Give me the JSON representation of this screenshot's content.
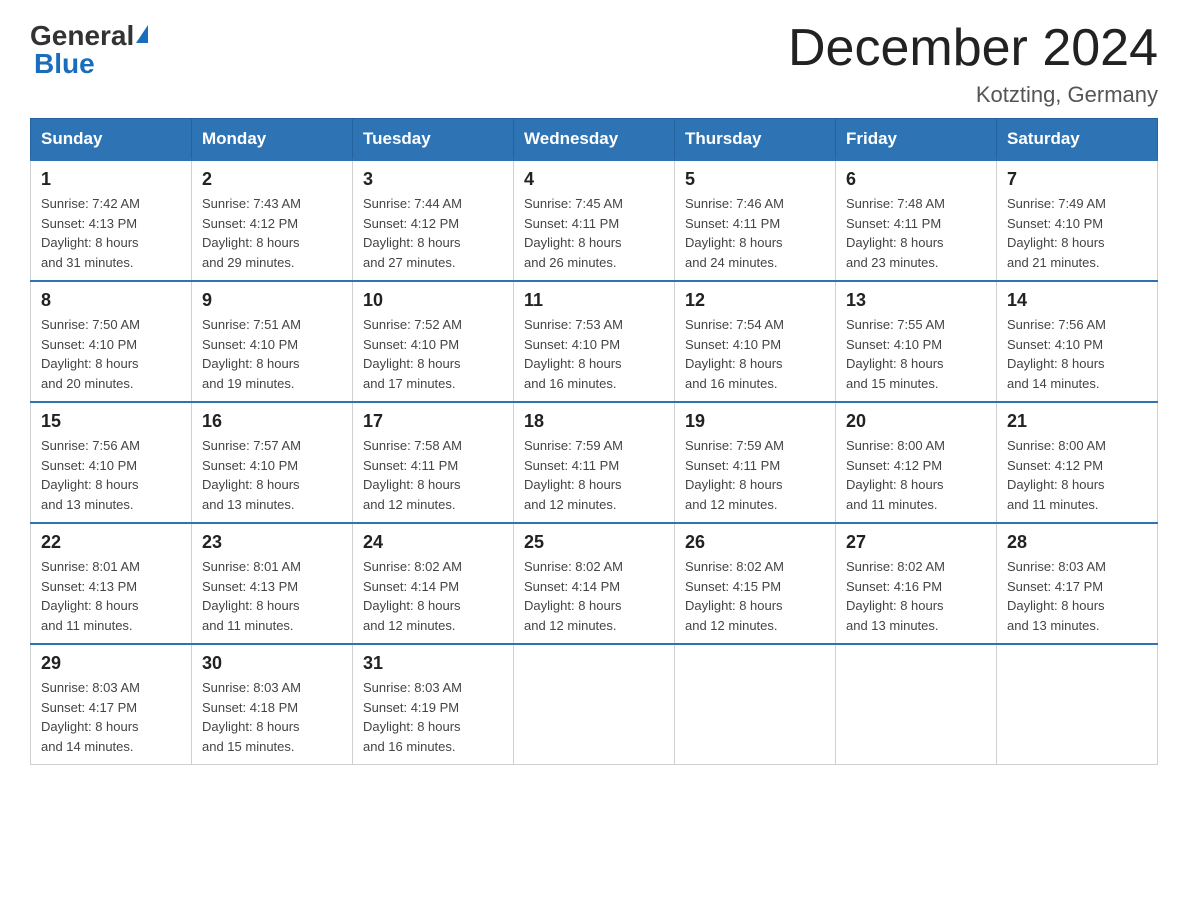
{
  "logo": {
    "general": "General",
    "blue": "Blue"
  },
  "title": "December 2024",
  "subtitle": "Kotzting, Germany",
  "days_header": [
    "Sunday",
    "Monday",
    "Tuesday",
    "Wednesday",
    "Thursday",
    "Friday",
    "Saturday"
  ],
  "weeks": [
    [
      {
        "day": "1",
        "sunrise": "7:42 AM",
        "sunset": "4:13 PM",
        "daylight": "8 hours and 31 minutes."
      },
      {
        "day": "2",
        "sunrise": "7:43 AM",
        "sunset": "4:12 PM",
        "daylight": "8 hours and 29 minutes."
      },
      {
        "day": "3",
        "sunrise": "7:44 AM",
        "sunset": "4:12 PM",
        "daylight": "8 hours and 27 minutes."
      },
      {
        "day": "4",
        "sunrise": "7:45 AM",
        "sunset": "4:11 PM",
        "daylight": "8 hours and 26 minutes."
      },
      {
        "day": "5",
        "sunrise": "7:46 AM",
        "sunset": "4:11 PM",
        "daylight": "8 hours and 24 minutes."
      },
      {
        "day": "6",
        "sunrise": "7:48 AM",
        "sunset": "4:11 PM",
        "daylight": "8 hours and 23 minutes."
      },
      {
        "day": "7",
        "sunrise": "7:49 AM",
        "sunset": "4:10 PM",
        "daylight": "8 hours and 21 minutes."
      }
    ],
    [
      {
        "day": "8",
        "sunrise": "7:50 AM",
        "sunset": "4:10 PM",
        "daylight": "8 hours and 20 minutes."
      },
      {
        "day": "9",
        "sunrise": "7:51 AM",
        "sunset": "4:10 PM",
        "daylight": "8 hours and 19 minutes."
      },
      {
        "day": "10",
        "sunrise": "7:52 AM",
        "sunset": "4:10 PM",
        "daylight": "8 hours and 17 minutes."
      },
      {
        "day": "11",
        "sunrise": "7:53 AM",
        "sunset": "4:10 PM",
        "daylight": "8 hours and 16 minutes."
      },
      {
        "day": "12",
        "sunrise": "7:54 AM",
        "sunset": "4:10 PM",
        "daylight": "8 hours and 16 minutes."
      },
      {
        "day": "13",
        "sunrise": "7:55 AM",
        "sunset": "4:10 PM",
        "daylight": "8 hours and 15 minutes."
      },
      {
        "day": "14",
        "sunrise": "7:56 AM",
        "sunset": "4:10 PM",
        "daylight": "8 hours and 14 minutes."
      }
    ],
    [
      {
        "day": "15",
        "sunrise": "7:56 AM",
        "sunset": "4:10 PM",
        "daylight": "8 hours and 13 minutes."
      },
      {
        "day": "16",
        "sunrise": "7:57 AM",
        "sunset": "4:10 PM",
        "daylight": "8 hours and 13 minutes."
      },
      {
        "day": "17",
        "sunrise": "7:58 AM",
        "sunset": "4:11 PM",
        "daylight": "8 hours and 12 minutes."
      },
      {
        "day": "18",
        "sunrise": "7:59 AM",
        "sunset": "4:11 PM",
        "daylight": "8 hours and 12 minutes."
      },
      {
        "day": "19",
        "sunrise": "7:59 AM",
        "sunset": "4:11 PM",
        "daylight": "8 hours and 12 minutes."
      },
      {
        "day": "20",
        "sunrise": "8:00 AM",
        "sunset": "4:12 PM",
        "daylight": "8 hours and 11 minutes."
      },
      {
        "day": "21",
        "sunrise": "8:00 AM",
        "sunset": "4:12 PM",
        "daylight": "8 hours and 11 minutes."
      }
    ],
    [
      {
        "day": "22",
        "sunrise": "8:01 AM",
        "sunset": "4:13 PM",
        "daylight": "8 hours and 11 minutes."
      },
      {
        "day": "23",
        "sunrise": "8:01 AM",
        "sunset": "4:13 PM",
        "daylight": "8 hours and 11 minutes."
      },
      {
        "day": "24",
        "sunrise": "8:02 AM",
        "sunset": "4:14 PM",
        "daylight": "8 hours and 12 minutes."
      },
      {
        "day": "25",
        "sunrise": "8:02 AM",
        "sunset": "4:14 PM",
        "daylight": "8 hours and 12 minutes."
      },
      {
        "day": "26",
        "sunrise": "8:02 AM",
        "sunset": "4:15 PM",
        "daylight": "8 hours and 12 minutes."
      },
      {
        "day": "27",
        "sunrise": "8:02 AM",
        "sunset": "4:16 PM",
        "daylight": "8 hours and 13 minutes."
      },
      {
        "day": "28",
        "sunrise": "8:03 AM",
        "sunset": "4:17 PM",
        "daylight": "8 hours and 13 minutes."
      }
    ],
    [
      {
        "day": "29",
        "sunrise": "8:03 AM",
        "sunset": "4:17 PM",
        "daylight": "8 hours and 14 minutes."
      },
      {
        "day": "30",
        "sunrise": "8:03 AM",
        "sunset": "4:18 PM",
        "daylight": "8 hours and 15 minutes."
      },
      {
        "day": "31",
        "sunrise": "8:03 AM",
        "sunset": "4:19 PM",
        "daylight": "8 hours and 16 minutes."
      },
      null,
      null,
      null,
      null
    ]
  ],
  "labels": {
    "sunrise": "Sunrise:",
    "sunset": "Sunset:",
    "daylight": "Daylight:"
  }
}
